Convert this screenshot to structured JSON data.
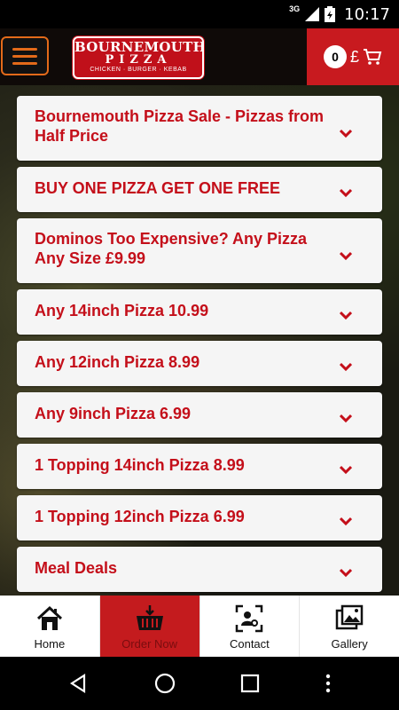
{
  "status_bar": {
    "network": "3G",
    "time": "10:17"
  },
  "header": {
    "logo": {
      "line1": "BOURNEMOUTH",
      "line2": "PIZZA",
      "line3": "CHICKEN · BURGER · KEBAB"
    },
    "cart": {
      "count": "0",
      "currency": "£"
    }
  },
  "menu_items": [
    {
      "label": "Bournemouth Pizza Sale - Pizzas from Half Price"
    },
    {
      "label": "BUY ONE PIZZA GET ONE FREE"
    },
    {
      "label": "Dominos Too Expensive? Any Pizza Any Size £9.99"
    },
    {
      "label": "Any 14inch Pizza 10.99"
    },
    {
      "label": "Any 12inch Pizza 8.99"
    },
    {
      "label": "Any 9inch Pizza 6.99"
    },
    {
      "label": "1 Topping 14inch Pizza 8.99"
    },
    {
      "label": "1 Topping 12inch Pizza 6.99"
    },
    {
      "label": "Meal Deals"
    }
  ],
  "bottom_nav": {
    "home": "Home",
    "order_now": "Order Now",
    "contact": "Contact",
    "gallery": "Gallery"
  },
  "colors": {
    "accent": "#c40f1a",
    "menu_orange": "#e36a1a"
  }
}
